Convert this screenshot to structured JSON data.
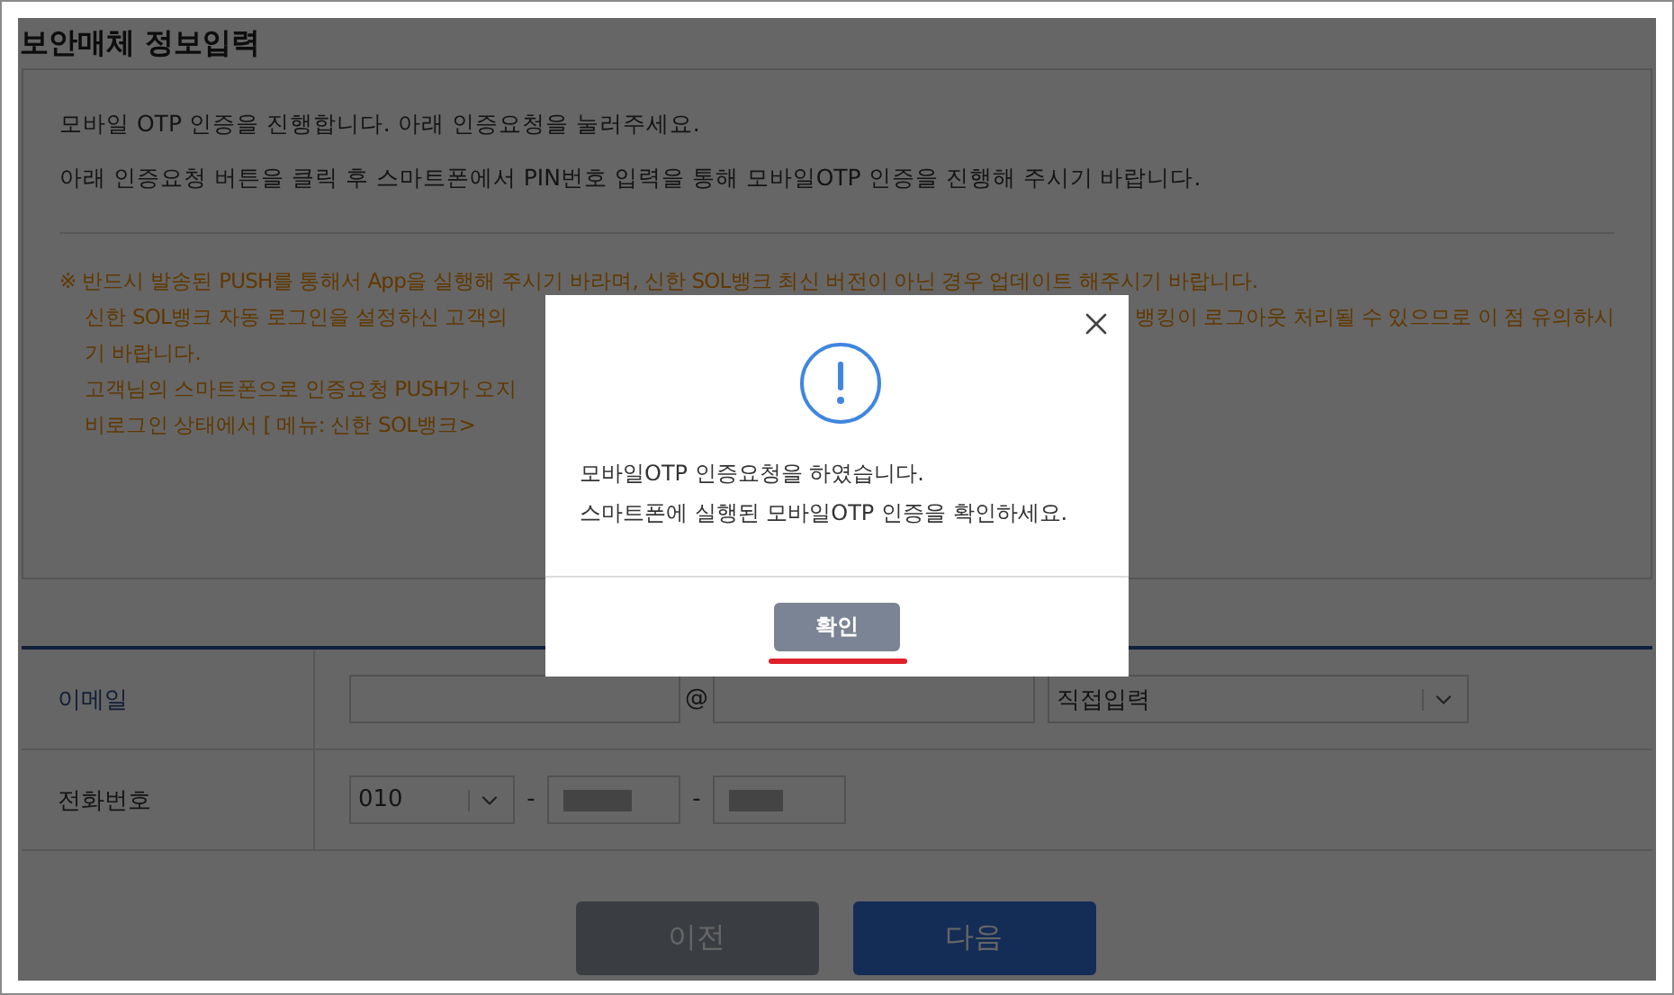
{
  "section_title": "보안매체 정보입력",
  "intro": [
    "모바일 OTP 인증을 진행합니다. 아래 인증요청을 눌러주세요.",
    "아래 인증요청 버튼을 클릭 후 스마트폰에서 PIN번호 입력을 통해 모바일OTP 인증을 진행해 주시기 바랍니다."
  ],
  "notice_lines": [
    {
      "text": "※ 반드시 발송된 PUSH를 통해서 App을 실행해 주시기 바라며, 신한 SOL뱅크 최신 버전이 아닌 경우 업데이트 해주시기 바랍니다.",
      "indent": false
    },
    {
      "text": "신한 SOL뱅크 자동 로그인을 설정하신 고객의",
      "text_right": "뱅킹이 로그아웃 처리될 수 있으므로 이 점 유의하시",
      "indent": true
    },
    {
      "text": "기 바랍니다.",
      "indent": true
    },
    {
      "text": "고객님의 스마트폰으로 인증요청 PUSH가 오지",
      "indent": true
    },
    {
      "text": "비로그인 상태에서 [ 메뉴: 신한 SOL뱅크>",
      "indent": true
    }
  ],
  "form_rows": [
    {
      "kind": "email",
      "label": "이메일",
      "at": "@",
      "domain_select": "직접입력"
    },
    {
      "kind": "phone",
      "label": "전화번호",
      "prefix_select": "010",
      "separators": [
        "-",
        "-"
      ]
    }
  ],
  "buttons": [
    {
      "kind": "secondary",
      "label": "이전"
    },
    {
      "kind": "primary",
      "label": "다음"
    }
  ],
  "dialog": {
    "message_lines": [
      "모바일OTP 인증요청을 하였습니다.",
      "스마트폰에 실행된 모바일OTP 인증을 확인하세요."
    ],
    "confirm": "확인",
    "confirm_highlighted": true
  }
}
